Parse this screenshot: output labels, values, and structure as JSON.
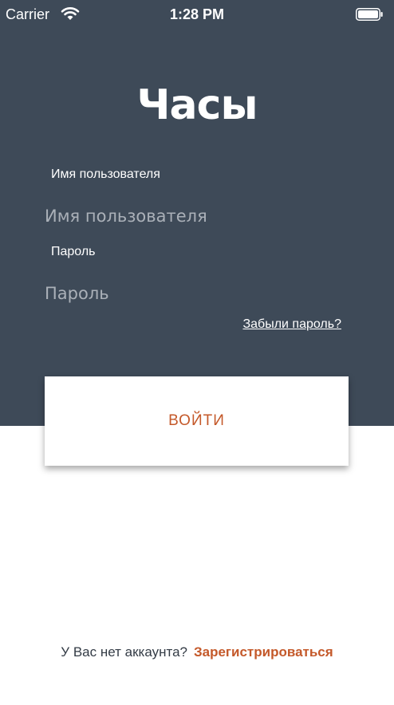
{
  "status_bar": {
    "carrier": "Carrier",
    "time": "1:28 PM",
    "wifi_icon": "wifi-icon",
    "battery_icon": "battery-icon"
  },
  "app": {
    "title": "Часы"
  },
  "login_form": {
    "username_label": "Имя пользователя",
    "username_placeholder": "Имя пользователя",
    "username_value": "",
    "password_label": "Пароль",
    "password_placeholder": "Пароль",
    "password_value": "",
    "forgot_password": "Забыли пароль?",
    "login_button": "ВОЙТИ"
  },
  "signup": {
    "prompt": "У Вас нет аккаунта?",
    "link": "Зарегистрироваться"
  },
  "colors": {
    "header_background": "#3e4a58",
    "accent": "#c4592a",
    "background": "#ffffff"
  }
}
